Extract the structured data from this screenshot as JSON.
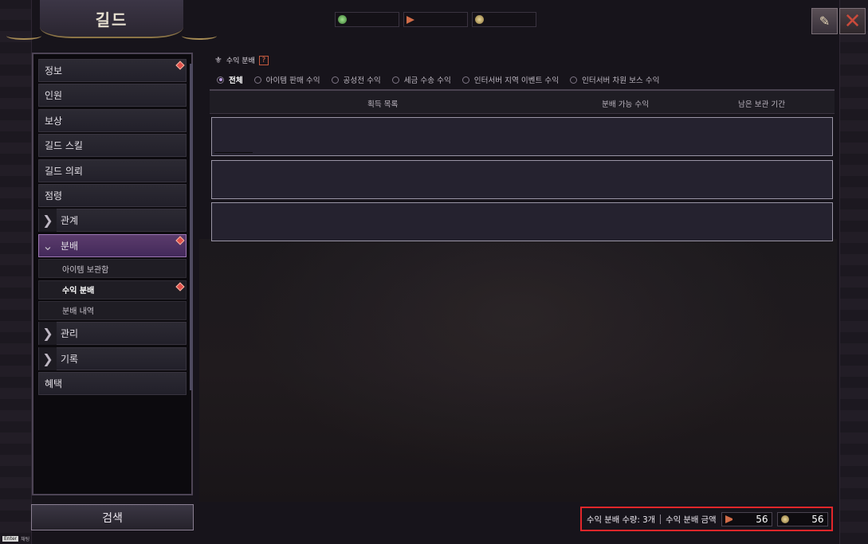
{
  "window": {
    "title": "길드"
  },
  "currencies": [
    {
      "icon": "green-gem-icon",
      "value": ""
    },
    {
      "icon": "flag-token-icon",
      "value": ""
    },
    {
      "icon": "gold-coin-icon",
      "value": ""
    }
  ],
  "sidebar": {
    "items": [
      {
        "label": "정보",
        "badge": true
      },
      {
        "label": "인원",
        "badge": false
      },
      {
        "label": "보상",
        "badge": false
      },
      {
        "label": "길드 스킬",
        "badge": false
      },
      {
        "label": "길드 의뢰",
        "badge": false
      },
      {
        "label": "점령",
        "badge": false
      },
      {
        "label": "관계",
        "expandable": true,
        "expanded": false
      },
      {
        "label": "분배",
        "expandable": true,
        "expanded": true,
        "badge": true,
        "children": [
          {
            "label": "아이템 보관함",
            "selected": false,
            "badge": false
          },
          {
            "label": "수익 분배",
            "selected": true,
            "badge": true
          },
          {
            "label": "분배 내역",
            "selected": false,
            "badge": false
          }
        ]
      },
      {
        "label": "관리",
        "expandable": true,
        "expanded": false
      },
      {
        "label": "기록",
        "expandable": true,
        "expanded": false
      },
      {
        "label": "혜택",
        "badge": false
      }
    ],
    "search_label": "검색",
    "enter_key": "Enter",
    "enter_hint": "채팅"
  },
  "main": {
    "section_title": "수익 분배",
    "help_label": "?",
    "filters": [
      {
        "label": "전체",
        "selected": true
      },
      {
        "label": "아이템 판매 수익",
        "selected": false
      },
      {
        "label": "공성전 수익",
        "selected": false
      },
      {
        "label": "세금 수송 수익",
        "selected": false
      },
      {
        "label": "인터서버 지역 이벤트 수익",
        "selected": false
      },
      {
        "label": "인터서버 차원 보스 수익",
        "selected": false
      }
    ],
    "columns": [
      "획득 목록",
      "분배 가능 수익",
      "남은 보관 기간"
    ],
    "rows": [
      {},
      {},
      {}
    ]
  },
  "summary": {
    "count_label": "수익 분배 수량: 3개",
    "amount_label": "수익 분배 금액",
    "amount_flag": "56",
    "amount_coin": "56"
  },
  "colors": {
    "accent_purple": "#5b3c6c",
    "badge_red": "#e0504a",
    "highlight_red": "#e3262a"
  }
}
